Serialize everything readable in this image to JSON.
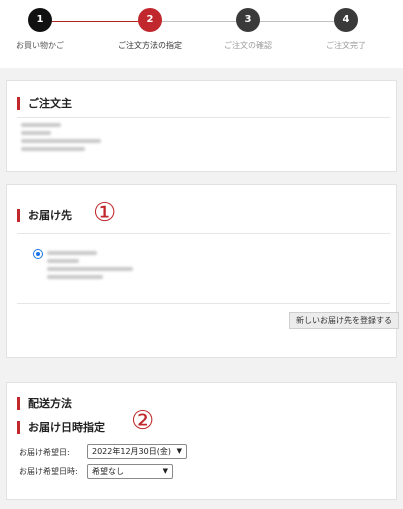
{
  "stepper": {
    "steps": [
      {
        "number": "1",
        "label": "お買い物かご",
        "color": "#111111"
      },
      {
        "number": "2",
        "label": "ご注文方法の指定",
        "color": "#c0282d"
      },
      {
        "number": "3",
        "label": "ご注文の確認",
        "color": "#3a3a3a"
      },
      {
        "number": "4",
        "label": "ご注文完了",
        "color": "#3a3a3a"
      }
    ]
  },
  "orderer": {
    "title": "ご注文主"
  },
  "delivery": {
    "title": "お届け先",
    "annotation": "①",
    "new_address_button": "新しいお届け先を登録する"
  },
  "shipping": {
    "method_title": "配送方法",
    "datetime_title": "お届け日時指定",
    "annotation": "②",
    "date_label": "お届け希望日:",
    "date_value": "2022年12月30日(金)",
    "time_label": "お届け希望日時:",
    "time_value": "希望なし"
  },
  "colors": {
    "accent": "#c0282d",
    "radio": "#1a73e8"
  }
}
